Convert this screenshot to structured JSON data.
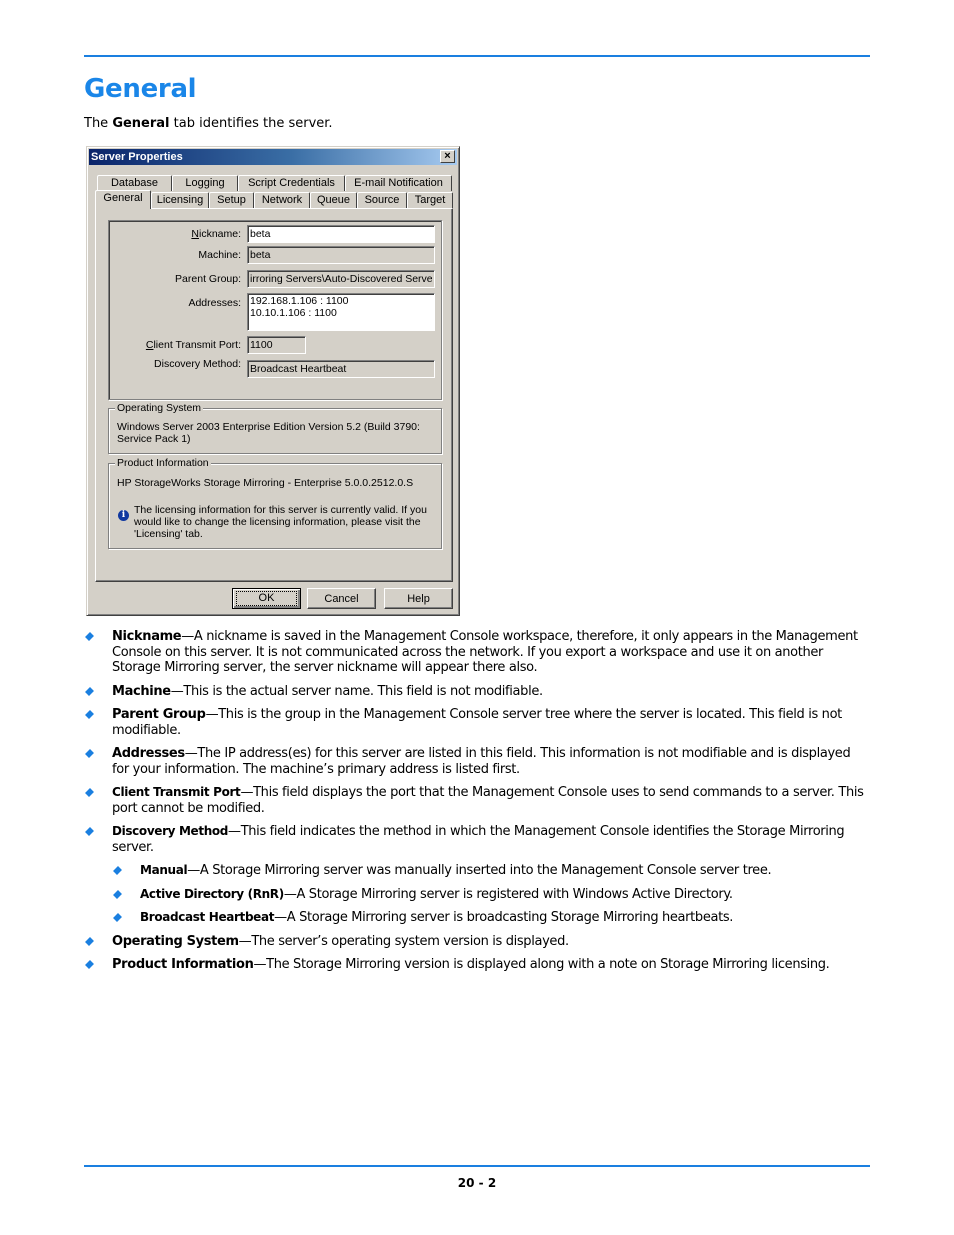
{
  "page": {
    "title": "General",
    "intro": {
      "prefix": "The ",
      "bold": "General",
      "suffix": " tab identifies the server."
    },
    "page_number": "20 - 2",
    "accent_color": "#1a7fe0"
  },
  "dialog": {
    "title": "Server Properties",
    "close_glyph": "×",
    "tabs_back_row": [
      "Database",
      "Logging",
      "Script Credentials",
      "E-mail Notification"
    ],
    "tabs_front_row": [
      "General",
      "Licensing",
      "Setup",
      "Network",
      "Queue",
      "Source",
      "Target"
    ],
    "active_tab": "General",
    "fields": {
      "nickname": {
        "label_u": "N",
        "label_rest": "ickname:",
        "value": "beta"
      },
      "machine": {
        "label": "Machine:",
        "value": "beta"
      },
      "parent_group": {
        "label": "Parent Group:",
        "value": "irroring Servers\\Auto-Discovered Servers"
      },
      "addresses": {
        "label": "Addresses:",
        "value": "192.168.1.106 : 1100\n10.10.1.106 : 1100"
      },
      "client_transmit_port": {
        "label_u": "C",
        "label_rest": "lient Transmit Port:",
        "value": "1100"
      },
      "discovery_method": {
        "label": "Discovery Method:",
        "value": "Broadcast Heartbeat"
      }
    },
    "operating_system": {
      "legend": "Operating System",
      "line1": "Windows Server 2003 Enterprise Edition Version 5.2 (Build 3790:",
      "line2": "Service Pack 1)"
    },
    "product_information": {
      "legend": "Product Information",
      "version": "HP StorageWorks Storage Mirroring - Enterprise 5.0.0.2512.0.S",
      "note_line1": "The licensing information for this server is currently valid. If you",
      "note_line2": "would like to change the licensing information, please visit the",
      "note_line3": "'Licensing' tab.",
      "info_glyph": "i"
    },
    "buttons": {
      "ok": "OK",
      "cancel": "Cancel",
      "help": "Help"
    }
  },
  "bullets": [
    {
      "term": "Nickname",
      "text": "—A nickname is saved in the Management Console workspace, therefore, it only appears in the Management Console on this server. It is not communicated across the network. If you export a workspace and use it on another Storage Mirroring server, the server nickname will appear there also."
    },
    {
      "term": "Machine",
      "text": "—This is the actual server name. This field is not modifiable."
    },
    {
      "term": "Parent Group",
      "text": "—This is the group in the Management Console server tree where the server is located. This field is not modifiable."
    },
    {
      "term": "Addresses",
      "text": "—The IP address(es) for this server are listed in this field. This information is not modifiable and is displayed for your information. The machine’s primary address is listed first."
    },
    {
      "term": "Client Transmit Port",
      "text": "—This field displays the port that the Management Console uses to send commands to a server. This port cannot be modified."
    },
    {
      "term": "Discovery Method",
      "text": "—This field indicates the method in which the Management Console identifies the Storage Mirroring server."
    },
    {
      "term": "Manual",
      "text": "—A Storage Mirroring server was manually inserted into the Management Console server tree."
    },
    {
      "term": "Active Directory (RnR)",
      "text": "—A Storage Mirroring server is registered with Windows Active Directory."
    },
    {
      "term": "Broadcast Heartbeat",
      "text": "—A Storage Mirroring server is broadcasting Storage Mirroring heartbeats."
    },
    {
      "term": "Operating System",
      "text": "—The server’s operating system version is displayed."
    },
    {
      "term": "Product Information",
      "text": "—The Storage Mirroring version is displayed along with a note on Storage Mirroring licensing."
    }
  ]
}
